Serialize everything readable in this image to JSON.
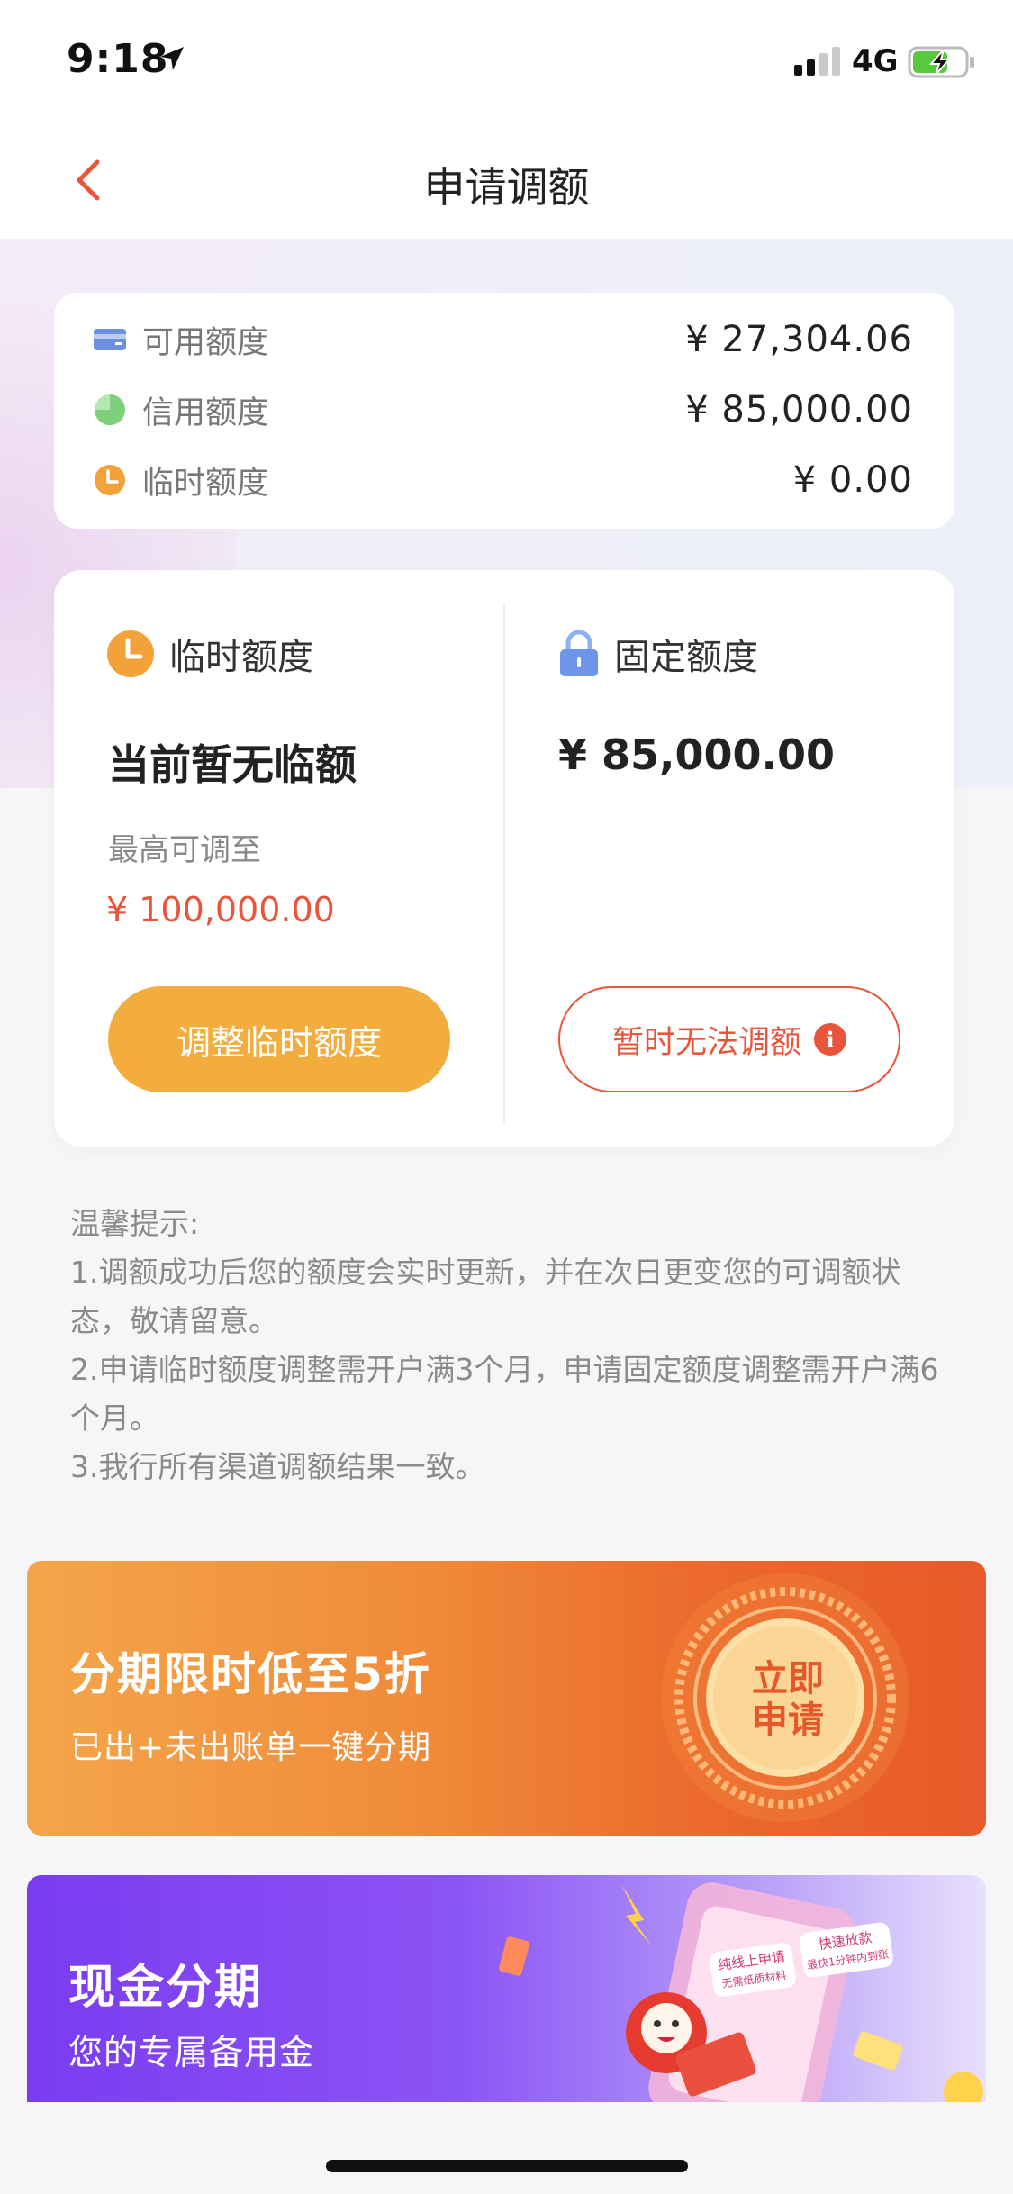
{
  "status_bar": {
    "time": "9:18",
    "network": "4G"
  },
  "nav": {
    "title": "申请调额"
  },
  "summary": {
    "rows": [
      {
        "label": "可用额度",
        "value": "¥ 27,304.06"
      },
      {
        "label": "信用额度",
        "value": "¥ 85,000.00"
      },
      {
        "label": "临时额度",
        "value": "¥ 0.00"
      }
    ]
  },
  "temp_col": {
    "title": "临时额度",
    "status": "当前暂无临额",
    "max_label": "最高可调至",
    "max_value": "¥ 100,000.00",
    "button": "调整临时额度"
  },
  "fixed_col": {
    "title": "固定额度",
    "value": "¥ 85,000.00",
    "button": "暂时无法调额"
  },
  "tips": {
    "heading": "温馨提示:",
    "items": [
      "1.调额成功后您的额度会实时更新，并在次日更变您的可调额状态，敬请留意。",
      "2.申请临时额度调整需开户满3个月，申请固定额度调整需开户满6个月。",
      "3.我行所有渠道调额结果一致。"
    ]
  },
  "banner_installment": {
    "title": "分期限时低至5折",
    "subtitle": "已出+未出账单一键分期",
    "badge_line1": "立即",
    "badge_line2": "申请"
  },
  "banner_cash": {
    "title": "现金分期",
    "subtitle": "您的专属备用金",
    "tag1": "纯线上申请",
    "tag1_sub": "无需纸质材料",
    "tag2": "快速放款",
    "tag2_sub": "最快1分钟内到账"
  },
  "colors": {
    "accent_red": "#e8553a",
    "button_orange": "#f2ad3e",
    "card_icon_blue": "#6d8fe0",
    "pie_icon_green": "#7ed07a",
    "clock_icon_orange": "#f3a23a"
  }
}
